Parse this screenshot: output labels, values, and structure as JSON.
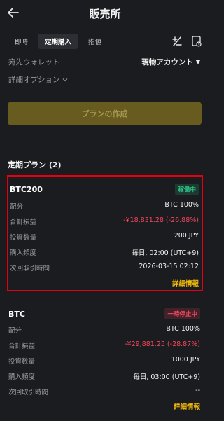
{
  "header": {
    "title": "販売所",
    "back_icon": "back-arrow-icon"
  },
  "tabs": [
    {
      "label": "即時",
      "active": false
    },
    {
      "label": "定期購入",
      "active": true
    },
    {
      "label": "指値",
      "active": false
    }
  ],
  "toolbar": {
    "icons": [
      "plus-minus-icon",
      "calendar-icon"
    ]
  },
  "wallet": {
    "label": "宛先ウォレット",
    "value": "現物アカウント"
  },
  "options": {
    "label": "詳細オプション"
  },
  "create_button": {
    "label": "プランの作成"
  },
  "section": {
    "title": "定期プラン (2)"
  },
  "plans": [
    {
      "name": "BTC200",
      "status": "稼働中",
      "rows": [
        {
          "key": "配分",
          "value": "BTC 100%"
        },
        {
          "key": "合計損益",
          "value": "-¥18,831.28 (-26.88%)"
        },
        {
          "key": "投資数量",
          "value": "200 JPY"
        },
        {
          "key": "購入頻度",
          "value": "毎日, 02:00 (UTC+9)"
        },
        {
          "key": "次回取引時間",
          "value": "2026-03-15 02:12"
        }
      ],
      "details_label": "詳細情報"
    },
    {
      "name": "BTC",
      "status": "一時停止中",
      "rows": [
        {
          "key": "配分",
          "value": "BTC 100%"
        },
        {
          "key": "合計損益",
          "value": "-¥29,881.25 (-28.87%)"
        },
        {
          "key": "投資数量",
          "value": "1000 JPY"
        },
        {
          "key": "購入頻度",
          "value": "毎日, 03:00 (UTC+9)"
        },
        {
          "key": "次回取引時間",
          "value": "--"
        }
      ],
      "details_label": "詳細情報"
    }
  ],
  "colors": {
    "background": "#1b1c1f",
    "accent": "#f0b90b",
    "negative": "#f6465d",
    "positive": "#2ebd85",
    "highlight_border": "#e3000f"
  }
}
